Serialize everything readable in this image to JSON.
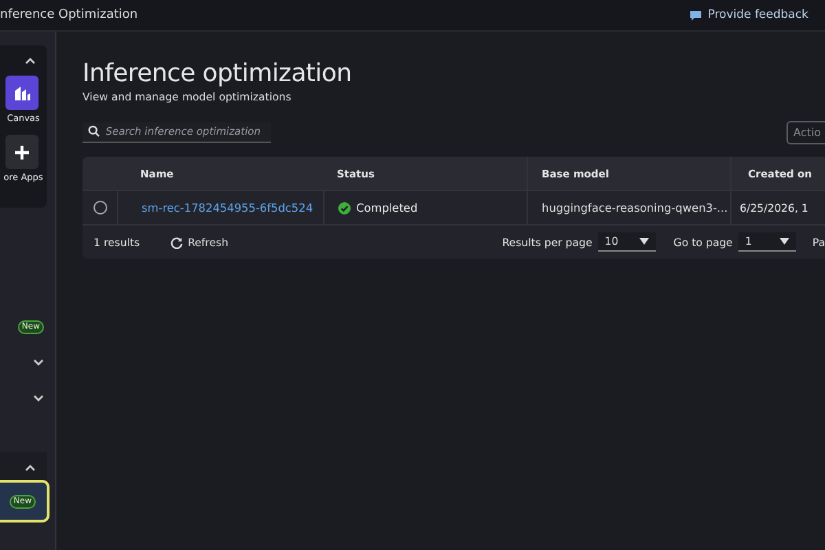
{
  "top_bar": {
    "title": "nference Optimization",
    "feedback": "Provide feedback"
  },
  "sidebar": {
    "apps_expanded": true,
    "apps": [
      {
        "kind": "canvas",
        "label": "Canvas"
      },
      {
        "kind": "more",
        "label": "ore Apps"
      }
    ],
    "items": [
      {
        "badge": "New",
        "kind": "badge"
      },
      {
        "kind": "chevron",
        "expanded": false
      },
      {
        "kind": "chevron",
        "expanded": false
      }
    ],
    "section_expanded": true,
    "section_items": [
      {
        "badge": "New",
        "selected": true
      }
    ]
  },
  "page": {
    "title": "Inference optimization",
    "subtitle": "View and manage model optimizations",
    "search": {
      "placeholder": "Search inference optimization"
    },
    "actions": "Actio"
  },
  "table": {
    "columns": [
      "Name",
      "Status",
      "Base model",
      "Created on"
    ],
    "rows": [
      {
        "selected": false,
        "name": "sm-rec-1782454955-6f5dc524",
        "status": "Completed",
        "base_model": "huggingface-reasoning-qwen3-...",
        "created_on": "6/25/2026, 1"
      }
    ],
    "footer": {
      "count": "1 results",
      "refresh": "Refresh",
      "per_page_label": "Results per page",
      "per_page": "10",
      "go_label": "Go to page",
      "go": "1",
      "page_label": "Pa"
    }
  }
}
